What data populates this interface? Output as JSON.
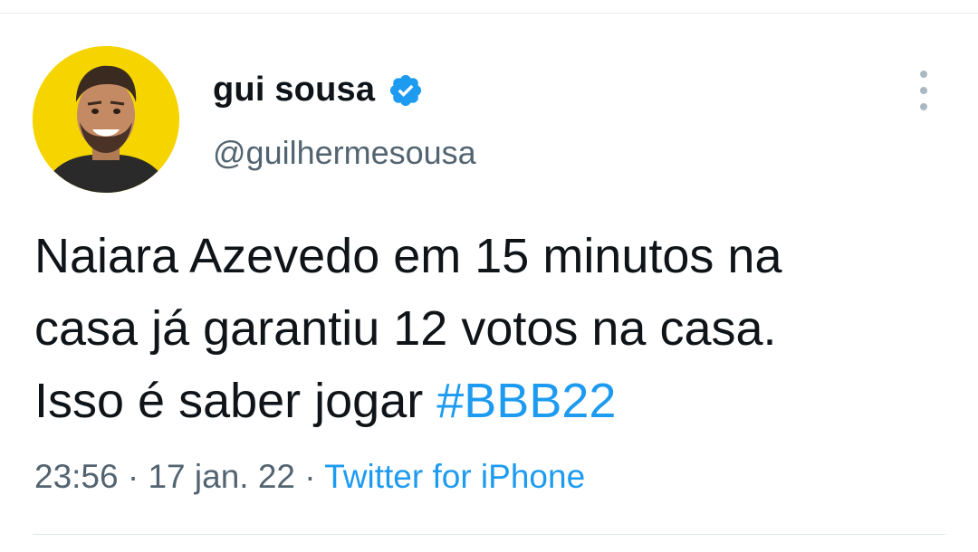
{
  "author": {
    "display_name": "gui sousa",
    "handle": "@guilhermesousa",
    "verified": true
  },
  "tweet": {
    "lines": [
      "Naiara Azevedo em 15 minutos na",
      "casa já garantiu 12 votos na casa.",
      "Isso é saber jogar"
    ],
    "hashtag": "#BBB22"
  },
  "meta": {
    "time": "23:56",
    "separator": " · ",
    "date": "17 jan. 22",
    "source": "Twitter for iPhone"
  },
  "colors": {
    "accent": "#1d9bf0",
    "text": "#0f1419",
    "muted": "#536471",
    "avatar_bg": "#f5d400"
  },
  "icons": {
    "verified": "verified-badge-icon",
    "more": "more-vertical-icon"
  }
}
